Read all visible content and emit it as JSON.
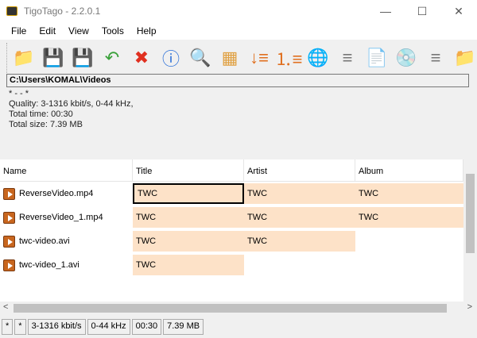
{
  "window": {
    "title": "TigoTago - 2.2.0.1",
    "minimize": "—",
    "maximize": "☐",
    "close": "✕"
  },
  "menu": [
    "File",
    "Edit",
    "View",
    "Tools",
    "Help"
  ],
  "toolbar": [
    {
      "name": "open-folder-icon",
      "glyph": "📁",
      "color": "#b8915a"
    },
    {
      "name": "save-icon",
      "glyph": "💾",
      "color": "#2a6fd8"
    },
    {
      "name": "save-all-icon",
      "glyph": "💾",
      "color": "#2a6fd8"
    },
    {
      "name": "undo-icon",
      "glyph": "↶",
      "color": "#3aa13a"
    },
    {
      "name": "delete-icon",
      "glyph": "✖",
      "color": "#e03020"
    },
    {
      "name": "info-icon",
      "glyph": "ⓘ",
      "color": "#2a6fd8"
    },
    {
      "name": "find-edit-icon",
      "glyph": "🔍",
      "color": "#666"
    },
    {
      "name": "columns-icon",
      "glyph": "▦",
      "color": "#e0a040"
    },
    {
      "name": "sort-list-icon",
      "glyph": "↓≡",
      "color": "#e07020"
    },
    {
      "name": "numbered-list-icon",
      "glyph": "⒈≡",
      "color": "#e07020"
    },
    {
      "name": "web-tags-icon",
      "glyph": "🌐",
      "color": "#3a9a3a"
    },
    {
      "name": "tags-from-list-icon",
      "glyph": "≡",
      "color": "#777"
    },
    {
      "name": "tags-from-text-icon",
      "glyph": "📄",
      "color": "#777"
    },
    {
      "name": "tags-from-cd-icon",
      "glyph": "💿",
      "color": "#777"
    },
    {
      "name": "tags-to-list-icon",
      "glyph": "≡",
      "color": "#777"
    },
    {
      "name": "folder-tags-icon",
      "glyph": "📁",
      "color": "#b8915a"
    }
  ],
  "path": "C:\\Users\\KOMAL\\Videos",
  "info": {
    "line0": "* - - *",
    "quality": "Quality: 3-1316 kbit/s, 0-44 kHz,",
    "time": "Total time: 00:30",
    "size": "Total size: 7.39 MB"
  },
  "columns": [
    "Name",
    "Title",
    "Artist",
    "Album"
  ],
  "rows": [
    {
      "name": "ReverseVideo.mp4",
      "title": "TWC",
      "artist": "TWC",
      "album": "TWC"
    },
    {
      "name": "ReverseVideo_1.mp4",
      "title": "TWC",
      "artist": "TWC",
      "album": "TWC"
    },
    {
      "name": "twc-video.avi",
      "title": "TWC",
      "artist": "TWC",
      "album": ""
    },
    {
      "name": "twc-video_1.avi",
      "title": "TWC",
      "artist": "",
      "album": ""
    }
  ],
  "status": [
    "*",
    "*",
    "3-1316 kbit/s",
    "0-44 kHz",
    "00:30",
    "7.39 MB"
  ],
  "colors": {
    "cell_fill": "#fde2c8"
  }
}
